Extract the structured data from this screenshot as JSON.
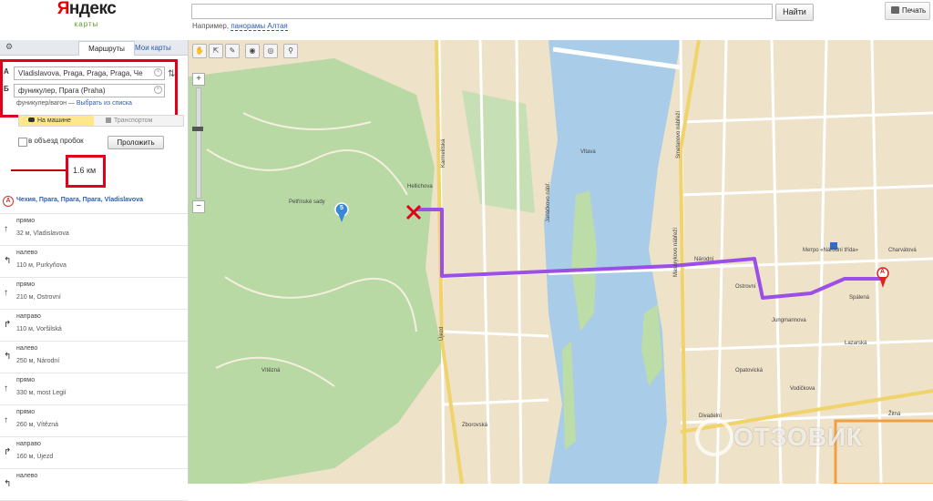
{
  "header": {
    "logo_main": "Яндекс",
    "logo_sub": "карты",
    "search_placeholder": "",
    "search_button": "Найти",
    "print_button": "Печать",
    "example_prefix": "Например,",
    "example_link": "панорамы Алтая"
  },
  "panel": {
    "tab_routes": "Маршруты",
    "tab_my_maps": "Мои карты",
    "point_a_letter": "А",
    "point_a_value": "Vladislavova, Praga, Praga, Praga, Че",
    "point_b_letter": "Б",
    "point_b_value": "фуникулер, Прага (Praha)",
    "sub_line_prefix": "фуникулер/вагон —",
    "sub_line_link": "Выбрать из списка",
    "mode_car": "На машине",
    "mode_transit": "Транспортом",
    "avoid_traffic_label": "в объезд пробок",
    "build_button": "Проложить",
    "distance": "1.6 км",
    "start_address": "Чехия, Прага, Прага, Прага, Vladislavova",
    "steps": [
      {
        "action": "прямо",
        "detail": "32 м, Vladislavova",
        "arrow": "↑"
      },
      {
        "action": "налево",
        "detail": "110 м, Purkyňova",
        "arrow": "↰"
      },
      {
        "action": "прямо",
        "detail": "210 м, Ostrovní",
        "arrow": "↑"
      },
      {
        "action": "направо",
        "detail": "110 м, Voršilská",
        "arrow": "↱"
      },
      {
        "action": "налево",
        "detail": "250 м, Národní",
        "arrow": "↰"
      },
      {
        "action": "прямо",
        "detail": "330 м, most Legií",
        "arrow": "↑"
      },
      {
        "action": "прямо",
        "detail": "260 м, Vítězná",
        "arrow": "↑"
      },
      {
        "action": "направо",
        "detail": "160 м, Újezd",
        "arrow": "↱"
      },
      {
        "action": "налево",
        "detail": "",
        "arrow": "↰"
      }
    ]
  },
  "map": {
    "route_color": "#9b4fe8",
    "river_color": "#a7cbe6",
    "park_color": "#b7d7a8",
    "marker_start": "A",
    "marker_end_icon": "red-cross-icon",
    "funicular_marker": "5",
    "metro_station": "Метро «Národní třída»",
    "street_labels": [
      "Újezd",
      "Hellichova",
      "Národní",
      "Karmelitská",
      "Vítězná",
      "Masarykovo nábřeží",
      "Smetanovo nábřeží",
      "Spálená",
      "Jungmannova",
      "Vodičkova",
      "Petřínské sady",
      "Janáčkovo nábř.",
      "Zborovská",
      "Vltava",
      "Charvátová",
      "Lazarská",
      "Opatovická",
      "Divadelní",
      "Ostrovní",
      "Žitná"
    ]
  },
  "watermark": "ОТЗОВИК"
}
